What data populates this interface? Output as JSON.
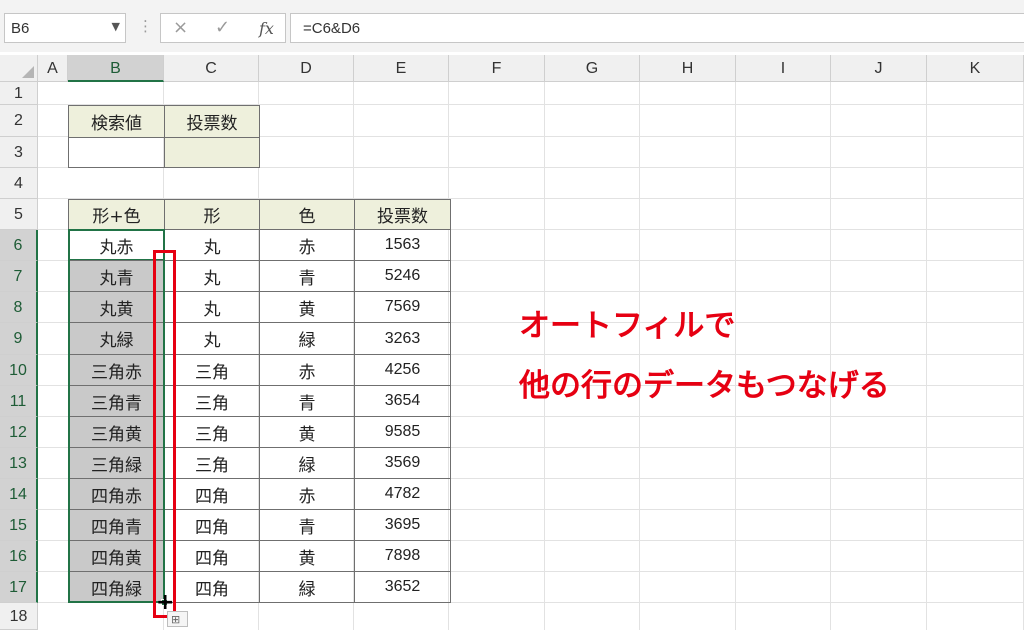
{
  "formula_bar": {
    "name_box": "B6",
    "cancel_icon": "×",
    "enter_icon": "✓",
    "fx_label": "fx",
    "formula": "=C6&D6"
  },
  "columns": [
    "A",
    "B",
    "C",
    "D",
    "E",
    "F",
    "G",
    "H",
    "I",
    "J",
    "K"
  ],
  "rows": [
    "1",
    "2",
    "3",
    "4",
    "5",
    "6",
    "7",
    "8",
    "9",
    "10",
    "11",
    "12",
    "13",
    "14",
    "15",
    "16",
    "17",
    "18"
  ],
  "search_table": {
    "headers": [
      "検索値",
      "投票数"
    ],
    "values": [
      "",
      ""
    ]
  },
  "main_table": {
    "headers": [
      "形+色",
      "形",
      "色",
      "投票数"
    ],
    "rows": [
      [
        "丸赤",
        "丸",
        "赤",
        "1563"
      ],
      [
        "丸青",
        "丸",
        "青",
        "5246"
      ],
      [
        "丸黄",
        "丸",
        "黄",
        "7569"
      ],
      [
        "丸緑",
        "丸",
        "緑",
        "3263"
      ],
      [
        "三角赤",
        "三角",
        "赤",
        "4256"
      ],
      [
        "三角青",
        "三角",
        "青",
        "3654"
      ],
      [
        "三角黄",
        "三角",
        "黄",
        "9585"
      ],
      [
        "三角緑",
        "三角",
        "緑",
        "3569"
      ],
      [
        "四角赤",
        "四角",
        "赤",
        "4782"
      ],
      [
        "四角青",
        "四角",
        "青",
        "3695"
      ],
      [
        "四角黄",
        "四角",
        "黄",
        "7898"
      ],
      [
        "四角緑",
        "四角",
        "緑",
        "3652"
      ]
    ]
  },
  "annotation": {
    "line1": "オートフィルで",
    "line2": "他の行のデータもつなげる"
  },
  "colors": {
    "accent_green": "#217346",
    "annotation_red": "#e60012",
    "header_fill": "#eef0dc"
  }
}
